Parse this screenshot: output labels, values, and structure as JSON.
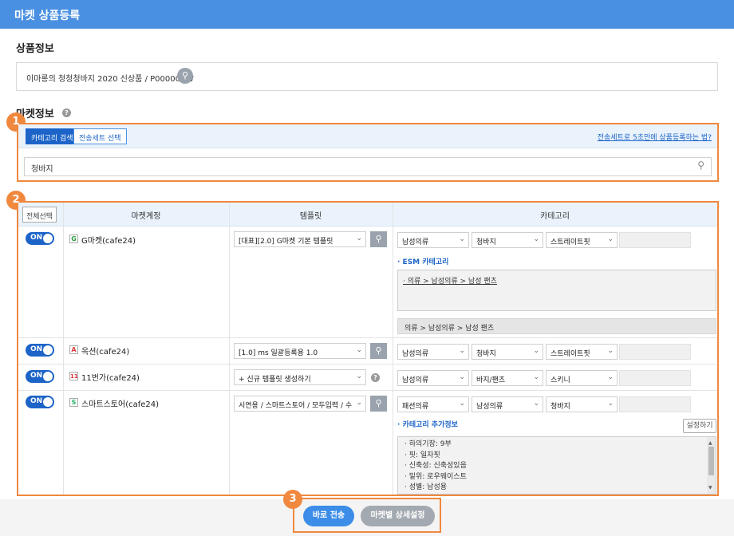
{
  "header": {
    "title": "마켓 상품등록"
  },
  "product_info": {
    "title": "상품정보",
    "product_text": "이마롱의 청청청바지 2020 신상품 / P0000OYW"
  },
  "market_info": {
    "title": "마켓정보",
    "help_glyph": "?",
    "badges": [
      "1",
      "2",
      "3"
    ],
    "tabs": [
      "카테고리 검색",
      "전송세트 선택"
    ],
    "link_text": "전송세트로 5초만에 상품등록하는 법?",
    "category_search_value": "청바지"
  },
  "table": {
    "select_all": "전체선택",
    "columns": [
      "마켓계정",
      "템플릿",
      "카테고리"
    ],
    "rows": [
      {
        "toggle": "ON",
        "market_icon": "G",
        "market_icon_color": "#2a9a3a",
        "market": "G마켓(cafe24)",
        "template": "[대표][2.0] G마켓 기본 템플릿",
        "categories": [
          "남성의류",
          "청바지",
          "스트레이트핏"
        ],
        "sub_title": "· ESM 카테고리",
        "esm_path": "· 의류 > 남성의류 > 남성 팬츠",
        "path_bar": "의류 > 남성의류 > 남성 팬츠"
      },
      {
        "toggle": "ON",
        "market_icon": "A",
        "market_icon_color": "#d93a3a",
        "market": "옥션(cafe24)",
        "template": "[1.0] ms 일괄등록용 1.0",
        "categories": [
          "남성의류",
          "청바지",
          "스트레이트핏"
        ]
      },
      {
        "toggle": "ON",
        "market_icon": "11",
        "market_icon_color": "#e03030",
        "market": "11번가(cafe24)",
        "template": "+ 신규 템플릿 생성하기",
        "categories": [
          "남성의류",
          "바지/팬츠",
          "스키니"
        ]
      },
      {
        "toggle": "ON",
        "market_icon": "S",
        "market_icon_color": "#25b36b",
        "market": "스마트스토어(cafe24)",
        "template": "시연용 / 스마트스토어 / 모두입력 / 수",
        "categories": [
          "패션의류",
          "남성의류",
          "청바지"
        ],
        "sub_title": "· 카테고리 추가정보",
        "settings_button": "설정하기",
        "extra_info": [
          "· 하의기장: 9부",
          "· 핏: 일자핏",
          "· 신축성: 신축성있음",
          "· 밑위: 로우웨이스트",
          "· 성별: 남성용"
        ]
      }
    ]
  },
  "footer": {
    "send_now": "바로 전송",
    "market_detail": "마켓별 상세설정"
  },
  "colors": {
    "header_blue": "#4a90e2",
    "accent_blue": "#1c64c8",
    "highlight_orange": "#f0883e",
    "grey_button": "#a3a9b0"
  }
}
